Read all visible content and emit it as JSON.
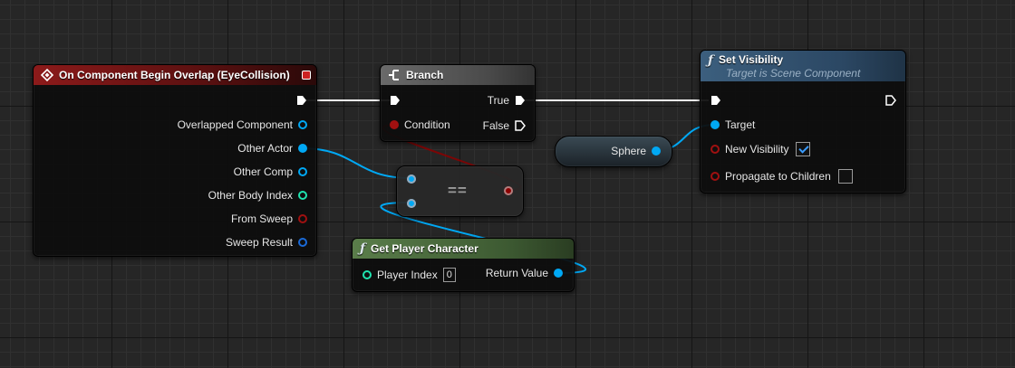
{
  "colors": {
    "exec": "#ffffff",
    "object": "#00a8f4",
    "struct": "#0058c8",
    "int": "#1fe3af",
    "bool": "#8c0000",
    "event_header": "#8c1a1a",
    "function_header": "#3c5f7e",
    "pure_header": "#5a7d4a"
  },
  "event_node": {
    "title": "On Component Begin Overlap (EyeCollision)",
    "icon": "event-diamond-icon",
    "outputs": [
      {
        "label": "Overlapped Component",
        "type": "object"
      },
      {
        "label": "Other Actor",
        "type": "object"
      },
      {
        "label": "Other Comp",
        "type": "object"
      },
      {
        "label": "Other Body Index",
        "type": "int"
      },
      {
        "label": "From Sweep",
        "type": "bool"
      },
      {
        "label": "Sweep Result",
        "type": "struct"
      }
    ]
  },
  "branch_node": {
    "title": "Branch",
    "icon": "branch-icon",
    "condition_label": "Condition",
    "true_label": "True",
    "false_label": "False"
  },
  "equal_node": {
    "operator": "=="
  },
  "get_player_node": {
    "title": "Get Player Character",
    "icon": "function-icon",
    "player_index_label": "Player Index",
    "player_index_value": "0",
    "return_label": "Return Value"
  },
  "sphere_node": {
    "label": "Sphere"
  },
  "set_visibility_node": {
    "title": "Set Visibility",
    "subtitle": "Target is Scene Component",
    "icon": "function-icon",
    "target_label": "Target",
    "new_visibility_label": "New Visibility",
    "new_visibility_checked": true,
    "propagate_label": "Propagate to Children",
    "propagate_checked": false
  }
}
